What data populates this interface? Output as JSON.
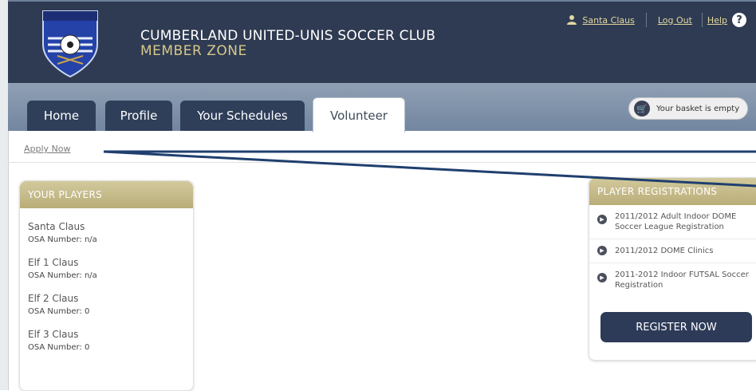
{
  "header": {
    "club_title": "CUMBERLAND UNITED-UNIS SOCCER CLUB",
    "club_subtitle": "MEMBER ZONE",
    "logo_text_top": "CUMBERLAND UNITED-UNIS",
    "user_link": "Santa Claus",
    "logout_link": "Log Out",
    "help_link": "Help",
    "help_symbol": "?"
  },
  "nav": {
    "tabs": [
      {
        "label": "Home"
      },
      {
        "label": "Profile"
      },
      {
        "label": "Your Schedules"
      },
      {
        "label": "Volunteer"
      }
    ],
    "active_tab": "Volunteer",
    "basket_label": "Your basket is empty"
  },
  "subnav": {
    "apply_now": "Apply Now"
  },
  "players_panel": {
    "title": "YOUR PLAYERS",
    "players": [
      {
        "name": "Santa Claus",
        "osa": "OSA Number: n/a"
      },
      {
        "name": "Elf 1 Claus",
        "osa": "OSA Number: n/a"
      },
      {
        "name": "Elf 2 Claus",
        "osa": "OSA Number: 0"
      },
      {
        "name": "Elf 3 Claus",
        "osa": "OSA Number: 0"
      }
    ]
  },
  "registrations_panel": {
    "title": "PLAYER REGISTRATIONS",
    "items": [
      {
        "label": "2011/2012 Adult Indoor DOME Soccer League Registration"
      },
      {
        "label": "2011/2012 DOME Clinics"
      },
      {
        "label": "2011-2012 Indoor FUTSAL Soccer Registration"
      }
    ],
    "register_button": "REGISTER NOW"
  },
  "colors": {
    "header_bg": "#2f3b52",
    "tab_bg": "#2f3f5a",
    "panel_header": "#c4ba88",
    "annotation_arrow": "#1f3f6e"
  }
}
